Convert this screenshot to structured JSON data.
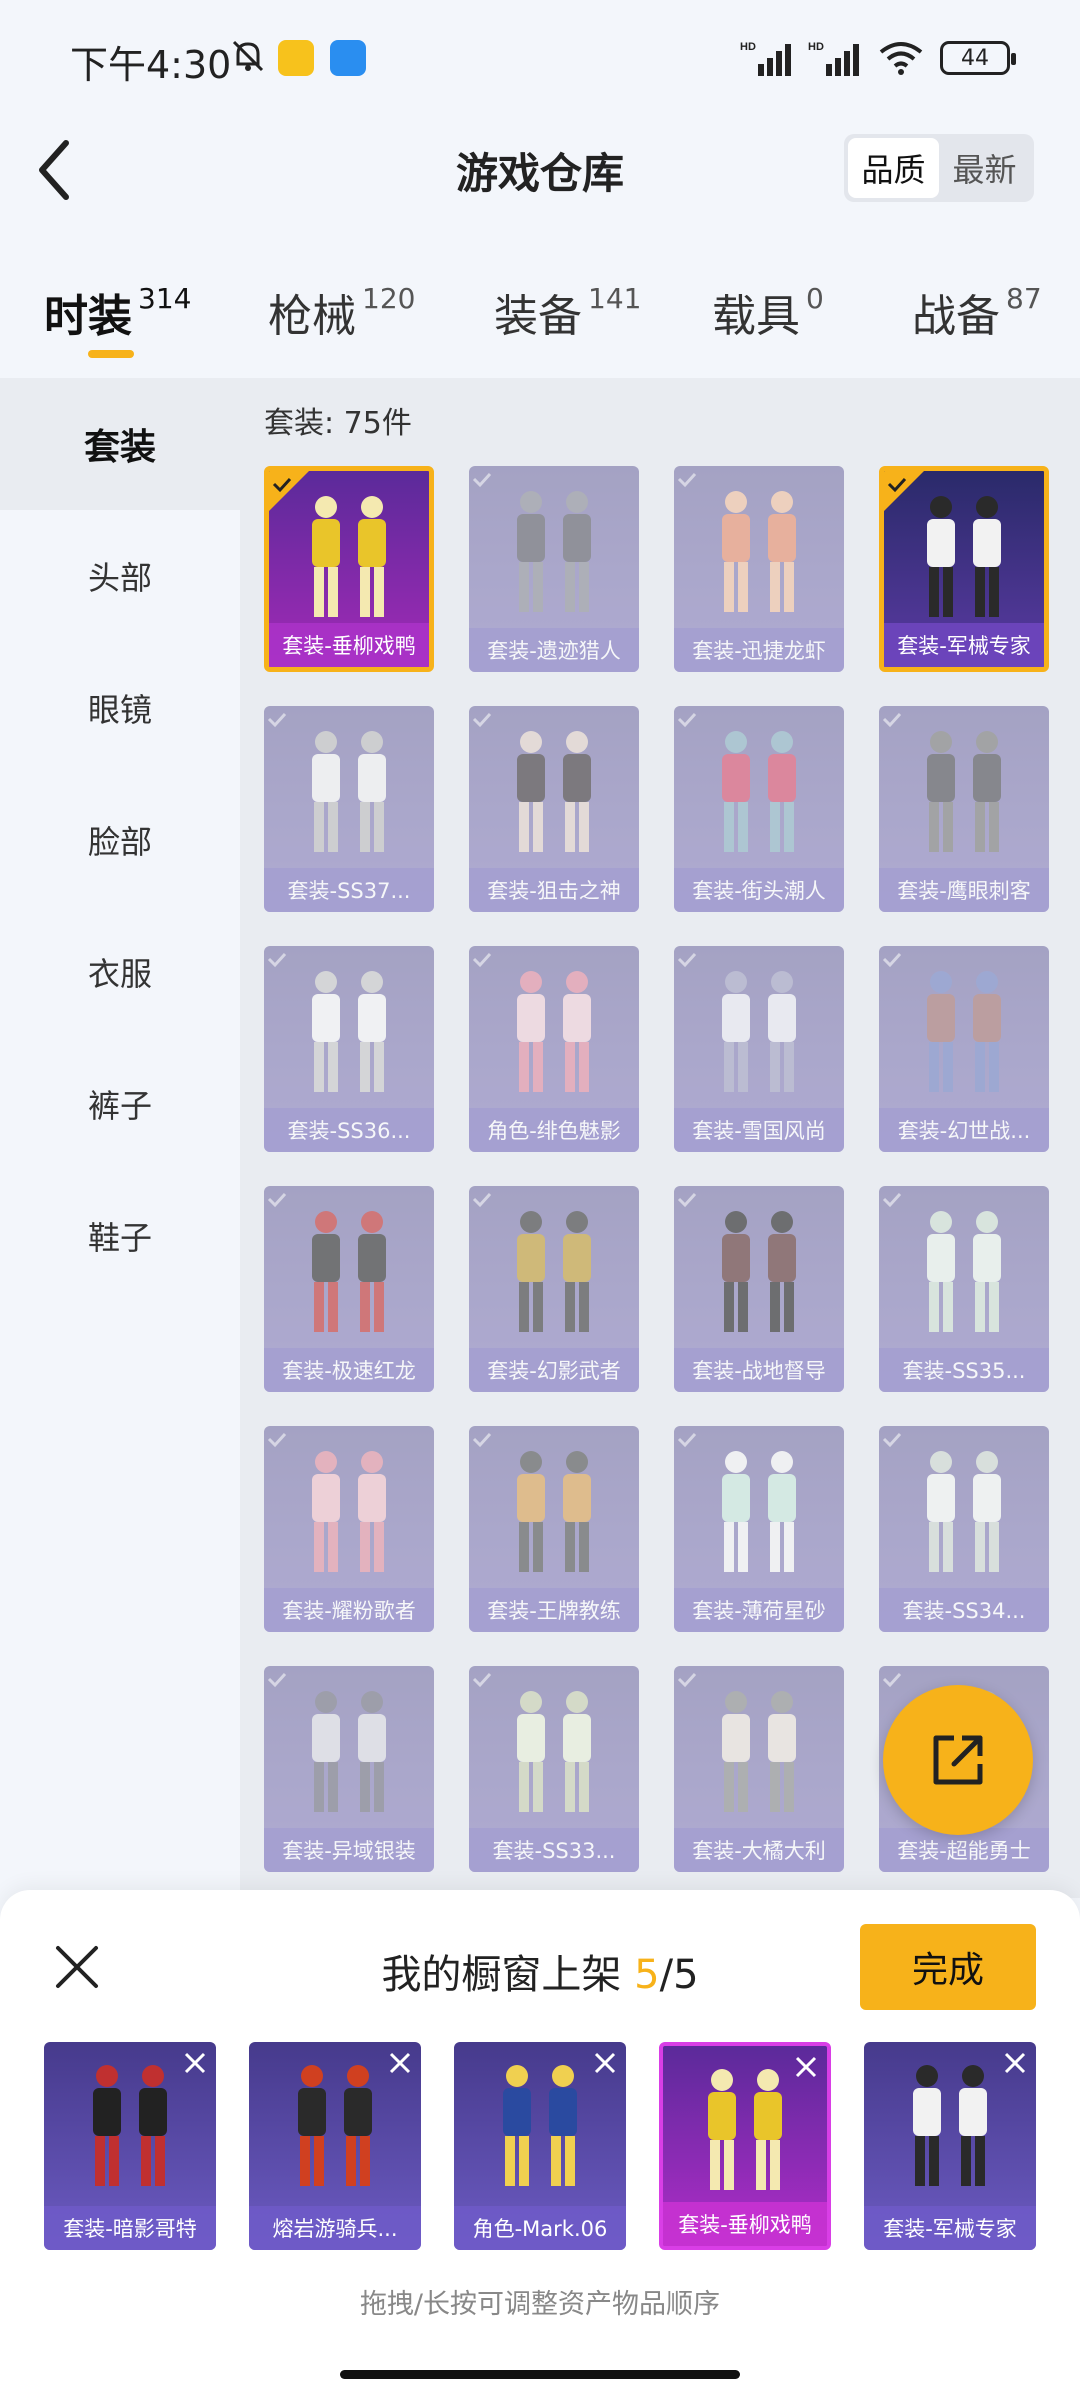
{
  "status": {
    "time": "下午4:30",
    "battery": "44",
    "network_1": "HD",
    "network_2": "HD"
  },
  "header": {
    "title": "游戏仓库",
    "sort_quality": "品质",
    "sort_latest": "最新"
  },
  "tabs": [
    {
      "label": "时装",
      "count": "314"
    },
    {
      "label": "枪械",
      "count": "120"
    },
    {
      "label": "装备",
      "count": "141"
    },
    {
      "label": "载具",
      "count": "0"
    },
    {
      "label": "战备",
      "count": "87"
    }
  ],
  "sidebar": [
    "套装",
    "头部",
    "眼镜",
    "脸部",
    "衣服",
    "裤子",
    "鞋子"
  ],
  "grid": {
    "count_label": "套装: 75件",
    "items": [
      "套装-垂柳戏鸭",
      "套装-遗迹猎人",
      "套装-迅捷龙虾",
      "套装-军械专家",
      "套装-SS37...",
      "套装-狙击之神",
      "套装-街头潮人",
      "套装-鹰眼刺客",
      "套装-SS36...",
      "角色-绯色魅影",
      "套装-雪国风尚",
      "套装-幻世战...",
      "套装-极速红龙",
      "套装-幻影武者",
      "套装-战地督导",
      "套装-SS35...",
      "套装-耀粉歌者",
      "套装-王牌教练",
      "套装-薄荷星砂",
      "套装-SS34...",
      "套装-异域银装",
      "套装-SS33...",
      "套装-大橘大利",
      "套装-超能勇士"
    ]
  },
  "sheet": {
    "title_prefix": "我的橱窗上架 ",
    "current": "5",
    "total": "/5",
    "done": "完成",
    "items": [
      "套装-暗影哥特",
      "熔岩游骑兵...",
      "角色-Mark.06",
      "套装-垂柳戏鸭",
      "套装-军械专家"
    ],
    "hint": "拖拽/长按可调整资产物品顺序"
  },
  "colors": {
    "accent": "#f7b21a",
    "background": "#f3f6fb"
  }
}
